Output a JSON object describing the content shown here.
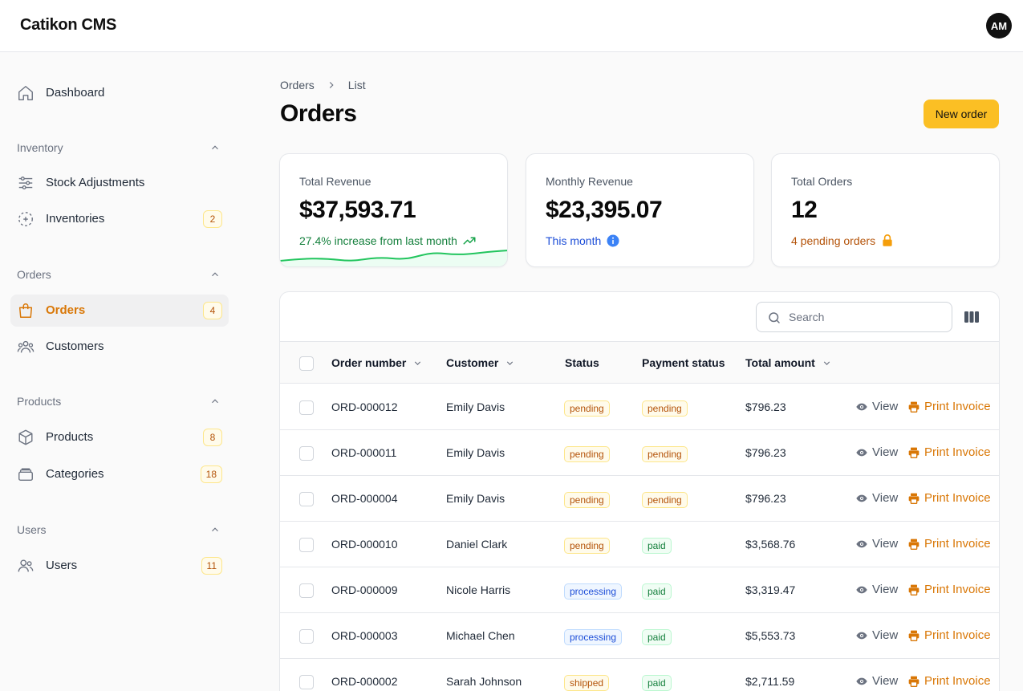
{
  "app": {
    "title": "Catikon CMS",
    "user_initials": "AM"
  },
  "sidebar": {
    "dashboard": "Dashboard",
    "groups": {
      "inventory": "Inventory",
      "orders": "Orders",
      "products": "Products",
      "users": "Users"
    },
    "items": {
      "stock_adjustments": {
        "label": "Stock Adjustments",
        "icon": "sliders-icon"
      },
      "inventories": {
        "label": "Inventories",
        "badge": "2",
        "icon": "scan-icon"
      },
      "orders": {
        "label": "Orders",
        "badge": "4",
        "icon": "shopping-bag-icon",
        "active": true
      },
      "customers": {
        "label": "Customers",
        "icon": "users-group-icon"
      },
      "products": {
        "label": "Products",
        "badge": "8",
        "icon": "cube-icon"
      },
      "categories": {
        "label": "Categories",
        "badge": "18",
        "icon": "stack-icon"
      },
      "users": {
        "label": "Users",
        "badge": "11",
        "icon": "user-icon"
      }
    }
  },
  "breadcrumb": {
    "root": "Orders",
    "current": "List"
  },
  "page": {
    "title": "Orders",
    "new_button": "New order"
  },
  "stats": {
    "total_revenue": {
      "label": "Total Revenue",
      "value": "$37,593.71",
      "description": "27.4% increase from last month",
      "color": "#15803d"
    },
    "monthly_revenue": {
      "label": "Monthly Revenue",
      "value": "$23,395.07",
      "description": "This month",
      "color": "#1d4ed8"
    },
    "total_orders": {
      "label": "Total Orders",
      "value": "12",
      "description": "4 pending orders",
      "color": "#b45309"
    }
  },
  "table": {
    "search_placeholder": "Search",
    "headers": {
      "order_number": "Order number",
      "customer": "Customer",
      "status": "Status",
      "payment_status": "Payment status",
      "total_amount": "Total amount"
    },
    "actions": {
      "view": "View",
      "print": "Print Invoice"
    },
    "rows": [
      {
        "order": "ORD-000012",
        "customer": "Emily Davis",
        "status": "pending",
        "payment": "pending",
        "total": "$796.23"
      },
      {
        "order": "ORD-000011",
        "customer": "Emily Davis",
        "status": "pending",
        "payment": "pending",
        "total": "$796.23"
      },
      {
        "order": "ORD-000004",
        "customer": "Emily Davis",
        "status": "pending",
        "payment": "pending",
        "total": "$796.23"
      },
      {
        "order": "ORD-000010",
        "customer": "Daniel Clark",
        "status": "pending",
        "payment": "paid",
        "total": "$3,568.76"
      },
      {
        "order": "ORD-000009",
        "customer": "Nicole Harris",
        "status": "processing",
        "payment": "paid",
        "total": "$3,319.47"
      },
      {
        "order": "ORD-000003",
        "customer": "Michael Chen",
        "status": "processing",
        "payment": "paid",
        "total": "$5,553.73"
      },
      {
        "order": "ORD-000002",
        "customer": "Sarah Johnson",
        "status": "shipped",
        "payment": "paid",
        "total": "$2,711.59"
      }
    ]
  },
  "colors": {
    "accent": "#f59e0b",
    "accent_text": "#d97706",
    "button": "#fbbf24"
  }
}
